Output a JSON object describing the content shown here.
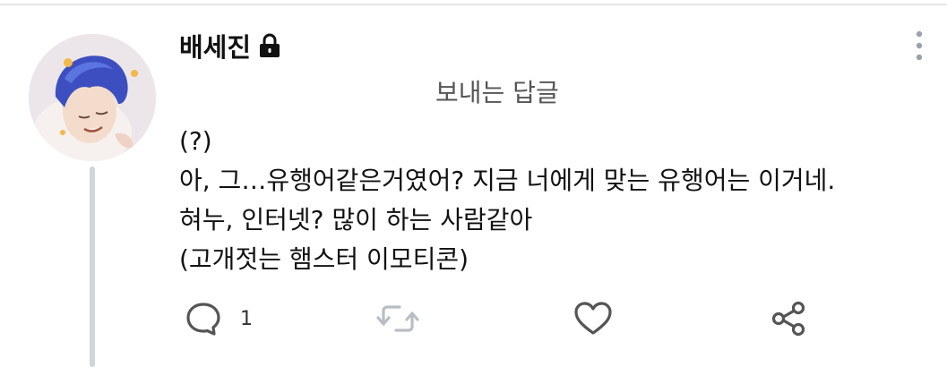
{
  "tweet": {
    "username": "배세진",
    "reply_label": "보내는 답글",
    "lines": [
      "(?)",
      "아, 그…유행어같은거였어? 지금 너에게 맞는 유행어는 이거네.",
      "혀누, 인터넷? 많이 하는 사람같아",
      "(고개젓는 햄스터 이모티콘)"
    ]
  },
  "actions": {
    "reply_count": "1"
  },
  "icons": {
    "lock": "lock-icon",
    "more": "more-vertical-icon",
    "reply": "comment-icon",
    "retweet": "retweet-icon",
    "like": "heart-icon",
    "share": "share-icon"
  },
  "colors": {
    "icon_gray": "#555555",
    "divider": "#e6e6e6",
    "thread_line": "#cfd5d9"
  }
}
